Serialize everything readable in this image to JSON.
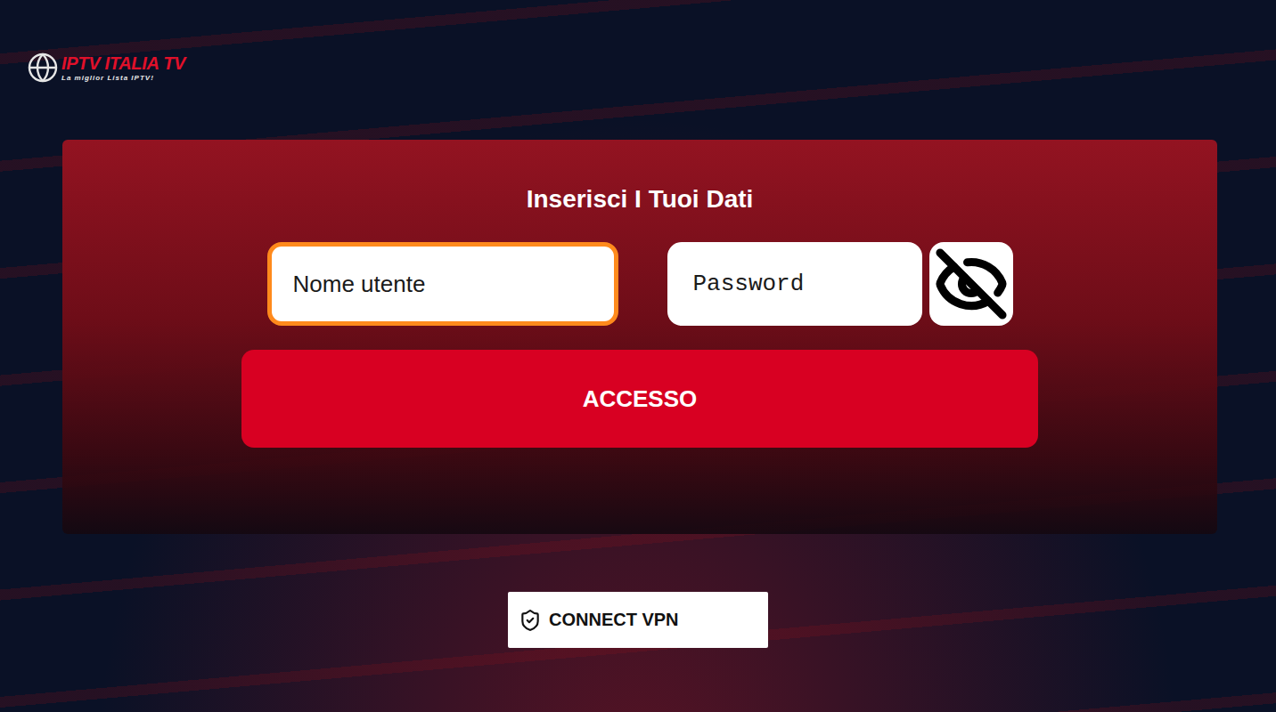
{
  "logo": {
    "title": "IPTV ITALIA TV",
    "subtitle": "La miglior Lista IPTV!"
  },
  "login_form": {
    "title": "Inserisci I Tuoi Dati",
    "username": {
      "placeholder": "Nome utente",
      "focused": true
    },
    "password": {
      "placeholder": "Password",
      "focused": false,
      "visible": false
    },
    "submit": {
      "label": "ACCESSO"
    }
  },
  "vpn_button": {
    "label": "CONNECT VPN"
  }
}
